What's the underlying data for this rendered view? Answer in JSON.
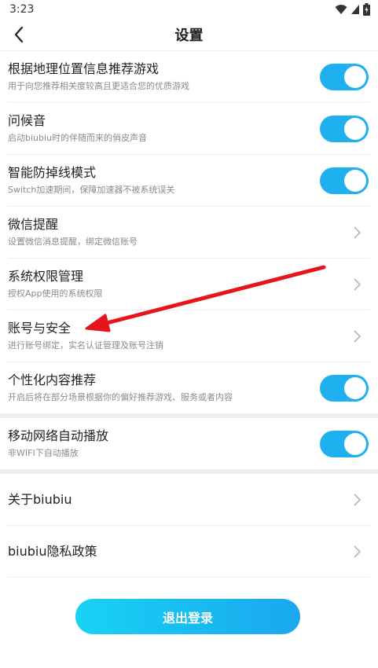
{
  "status_bar": {
    "time": "3:23"
  },
  "header": {
    "title": "设置"
  },
  "settings": [
    {
      "title": "根据地理位置信息推荐游戏",
      "subtitle": "用于向您推荐相关度较高且更适合您的优质游戏",
      "control": "toggle",
      "enabled": true
    },
    {
      "title": "问候音",
      "subtitle": "启动biubiu时的伴随而来的俏皮声音",
      "control": "toggle",
      "enabled": true
    },
    {
      "title": "智能防掉线模式",
      "subtitle": "Switch加速期间，保障加速器不被系统误关",
      "control": "toggle",
      "enabled": true
    },
    {
      "title": "微信提醒",
      "subtitle": "设置微信消息提醒，绑定微信账号",
      "control": "chevron"
    },
    {
      "title": "系统权限管理",
      "subtitle": "授权App使用的系统权限",
      "control": "chevron"
    },
    {
      "title": "账号与安全",
      "subtitle": "进行账号绑定，实名认证管理及账号注销",
      "control": "chevron"
    },
    {
      "title": "个性化内容推荐",
      "subtitle": "开启后将在部分场景根据你的偏好推荐游戏、服务或者内容",
      "control": "toggle",
      "enabled": true
    }
  ],
  "network": {
    "title": "移动网络自动播放",
    "subtitle": "非WIFI下自动播放",
    "enabled": true
  },
  "about": [
    {
      "title": "关于biubiu"
    },
    {
      "title": "biubiu隐私政策"
    }
  ],
  "logout": {
    "label": "退出登录"
  },
  "colors": {
    "accent": "#1fb0ef",
    "annotation_arrow": "#e8141b"
  }
}
